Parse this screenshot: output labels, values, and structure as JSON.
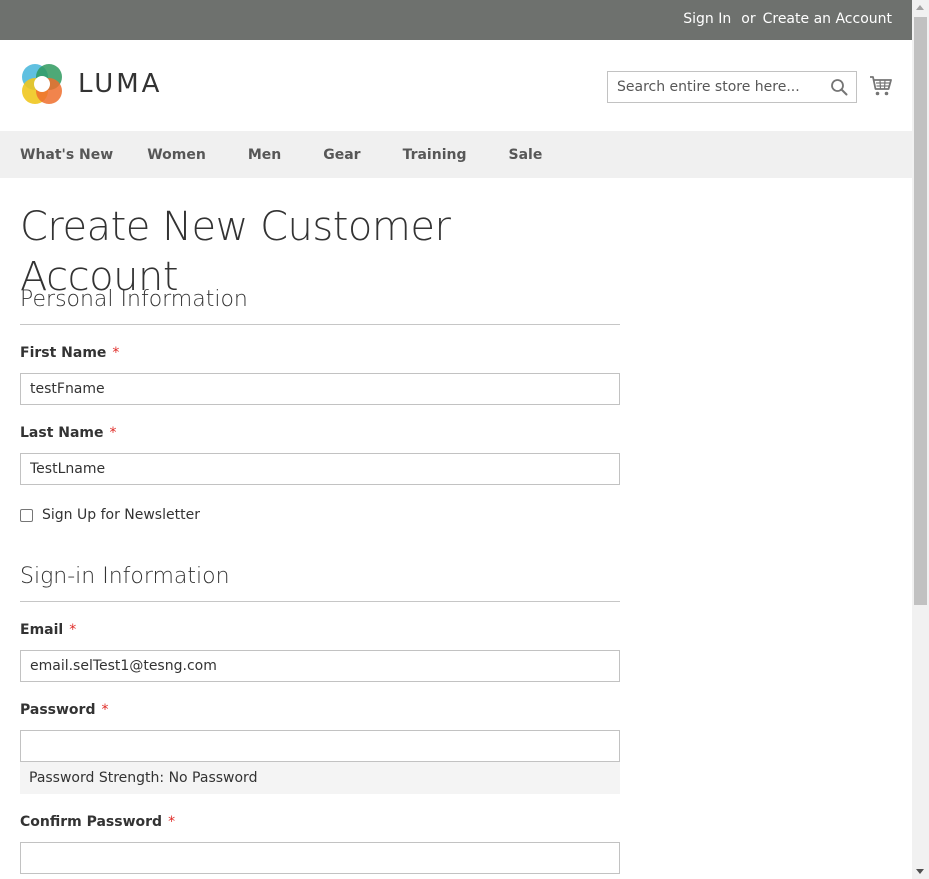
{
  "topbar": {
    "sign_in": "Sign In",
    "or": "or",
    "create_account": "Create an Account"
  },
  "header": {
    "logo_text": "LUMA",
    "search_placeholder": "Search entire store here...",
    "search_icon": "search-icon",
    "cart_icon": "shopping-cart-icon"
  },
  "nav": {
    "items": [
      "What's New",
      "Women",
      "Men",
      "Gear",
      "Training",
      "Sale"
    ]
  },
  "main": {
    "title": "Create New Customer Account",
    "personal": {
      "legend": "Personal Information",
      "first_name_label": "First Name",
      "first_name_value": "testFname",
      "last_name_label": "Last Name",
      "last_name_value": "TestLname",
      "newsletter_label": "Sign Up for Newsletter",
      "newsletter_checked": false
    },
    "signin": {
      "legend": "Sign-in Information",
      "email_label": "Email",
      "email_value": "email.selTest1@tesng.com",
      "password_label": "Password",
      "password_value": "",
      "strength_text": "Password Strength: No Password",
      "confirm_label": "Confirm Password",
      "confirm_value": ""
    },
    "required_mark": "*"
  },
  "colors": {
    "topbar_bg": "#6e716e",
    "nav_bg": "#f0f0f0",
    "required": "#e02b27"
  }
}
